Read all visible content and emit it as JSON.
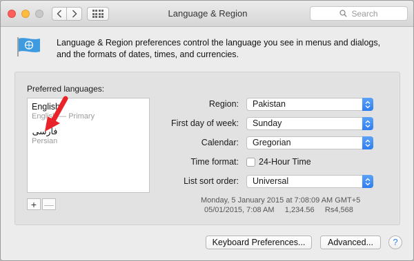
{
  "window": {
    "title": "Language & Region"
  },
  "search": {
    "placeholder": "Search"
  },
  "intro": {
    "line1": "Language & Region preferences control the language you see in menus and dialogs,",
    "line2": "and the formats of dates, times, and currencies."
  },
  "languages": {
    "label": "Preferred languages:",
    "items": [
      {
        "name": "English",
        "sub": "English — Primary"
      },
      {
        "name": "فارسی",
        "sub": "Persian"
      }
    ],
    "add": "+",
    "remove": "—"
  },
  "settings": {
    "region": {
      "label": "Region:",
      "value": "Pakistan"
    },
    "first_day": {
      "label": "First day of week:",
      "value": "Sunday"
    },
    "calendar": {
      "label": "Calendar:",
      "value": "Gregorian"
    },
    "time_format": {
      "label": "Time format:",
      "checkbox_label": "24-Hour Time",
      "checked": false
    },
    "list_sort": {
      "label": "List sort order:",
      "value": "Universal"
    }
  },
  "sample": {
    "line1": "Monday, 5 January 2015 at 7:08:09 AM GMT+5",
    "line2": "05/01/2015, 7:08 AM     1,234.56     Rs4,568"
  },
  "buttons": {
    "keyboard": "Keyboard Preferences...",
    "advanced": "Advanced...",
    "help": "?"
  },
  "colors": {
    "accent": "#2f7ef0",
    "annotation_arrow": "#e8232a"
  },
  "icons": {
    "flag": "un-flag-icon",
    "search": "search-icon"
  }
}
